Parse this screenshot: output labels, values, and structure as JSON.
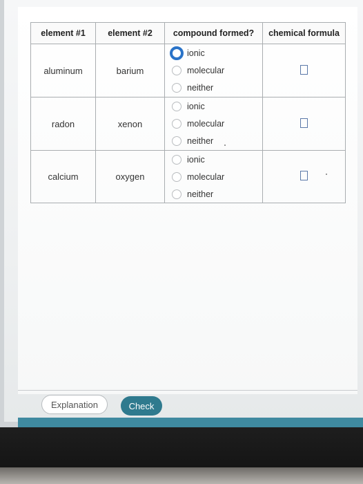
{
  "table": {
    "headers": [
      "element #1",
      "element #2",
      "compound formed?",
      "chemical formula"
    ],
    "option_labels": [
      "ionic",
      "molecular",
      "neither"
    ],
    "rows": [
      {
        "element1": "aluminum",
        "element2": "barium",
        "selected": "ionic"
      },
      {
        "element1": "radon",
        "element2": "xenon",
        "selected": ""
      },
      {
        "element1": "calcium",
        "element2": "oxygen",
        "selected": ""
      }
    ]
  },
  "buttons": {
    "explanation": "Explanation",
    "check": "Check"
  },
  "colors": {
    "accent_blue": "#2a73c8",
    "check_teal": "#2f7a8e",
    "footer_teal": "#3f8aa0"
  }
}
